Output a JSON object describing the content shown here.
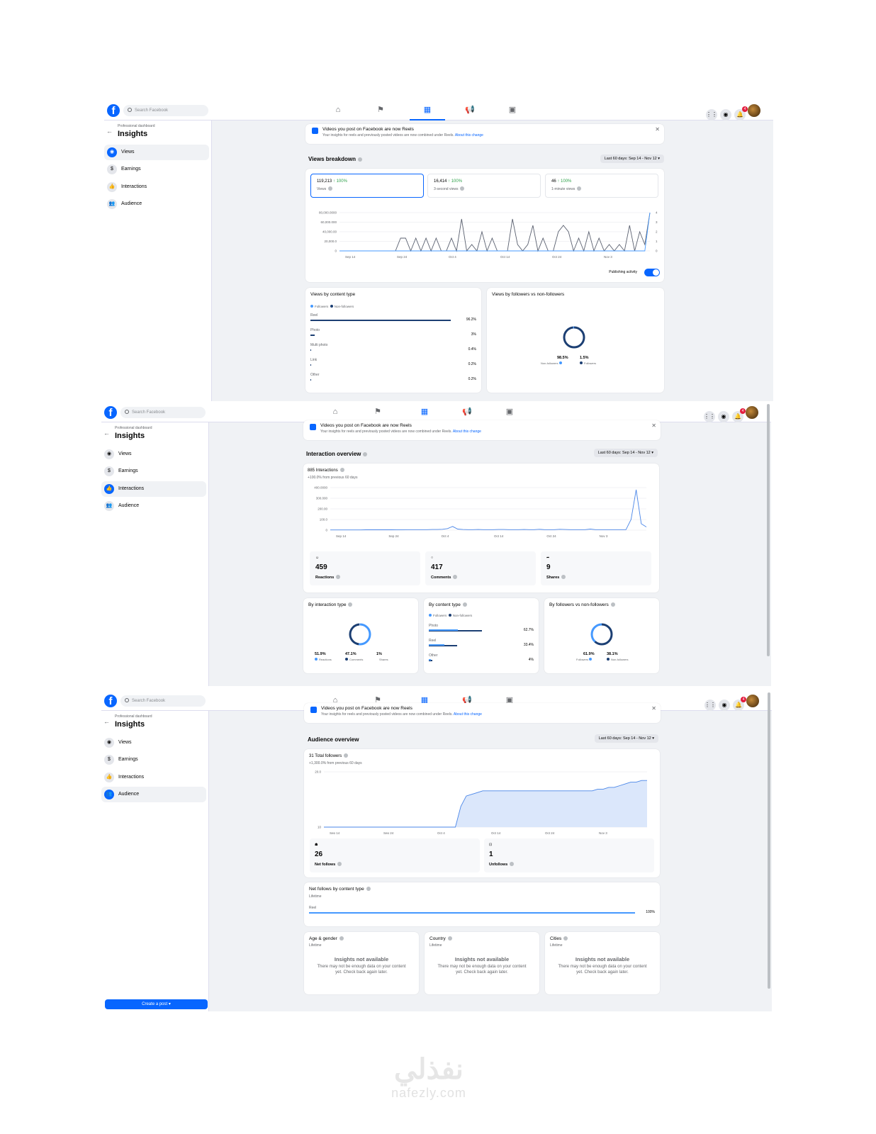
{
  "app": {
    "search_placeholder": "Search Facebook",
    "notif_count": "4",
    "dashboard_label": "Professional dashboard",
    "title": "Insights",
    "create_post": "Create a post ▾"
  },
  "menu": [
    {
      "label": "Views"
    },
    {
      "label": "Earnings"
    },
    {
      "label": "Interactions"
    },
    {
      "label": "Audience"
    }
  ],
  "notice": {
    "title": "Videos you post on Facebook are now Reels",
    "body": "Your insights for reels and previously posted videos are now combined under Reels.",
    "link": "About this change"
  },
  "range": "Last 60 days: Sep 14 - Nov 12 ▾",
  "views": {
    "section_title": "Views breakdown",
    "metrics": [
      {
        "value": "119,213",
        "change": "↑ 100%",
        "label": "Views"
      },
      {
        "value": "16,414",
        "change": "↑ 100%",
        "label": "3-second views"
      },
      {
        "value": "46",
        "change": "↑ 100%",
        "label": "1-minute views"
      }
    ],
    "publishing_label": "Publishing activity",
    "content_type": {
      "title": "Views by content type",
      "legend": [
        "Followers",
        "Non-followers"
      ],
      "rows": [
        {
          "label": "Reel",
          "value": "96.2%",
          "pct": 96.2
        },
        {
          "label": "Photo",
          "value": "3%",
          "pct": 3
        },
        {
          "label": "Multi photo",
          "value": "0.4%",
          "pct": 0.4
        },
        {
          "label": "Link",
          "value": "0.2%",
          "pct": 0.2
        },
        {
          "label": "Other",
          "value": "0.2%",
          "pct": 0.2
        }
      ]
    },
    "followers": {
      "title": "Views by followers vs non-followers",
      "items": [
        {
          "value": "98.5%",
          "label": "Non-followers"
        },
        {
          "value": "1.5%",
          "label": "Followers"
        }
      ]
    }
  },
  "interactions": {
    "section_title": "Interaction overview",
    "total": "885 Interactions",
    "change": "+100.0% from previous 60 days",
    "stats": [
      {
        "value": "459",
        "label": "Reactions"
      },
      {
        "value": "417",
        "label": "Comments"
      },
      {
        "value": "9",
        "label": "Shares"
      }
    ],
    "by_type": {
      "title": "By interaction type",
      "items": [
        {
          "value": "51.9%",
          "label": "Reactions"
        },
        {
          "value": "47.1%",
          "label": "Comments"
        },
        {
          "value": "1%",
          "label": "Shares"
        }
      ]
    },
    "by_content": {
      "title": "By content type",
      "legend": [
        "Followers",
        "Non-followers"
      ],
      "rows": [
        {
          "label": "Photo",
          "value": "62.7%",
          "pct": 62.7
        },
        {
          "label": "Reel",
          "value": "33.4%",
          "pct": 33.4
        },
        {
          "label": "Other",
          "value": "4%",
          "pct": 4
        }
      ]
    },
    "by_followers": {
      "title": "By followers vs non-followers",
      "items": [
        {
          "value": "61.9%",
          "label": "Followers"
        },
        {
          "value": "38.1%",
          "label": "Non-followers"
        }
      ]
    }
  },
  "audience": {
    "section_title": "Audience overview",
    "total": "31 Total followers",
    "change": "+1,300.0% from previous 60 days",
    "stats": [
      {
        "value": "26",
        "label": "Net follows"
      },
      {
        "value": "1",
        "label": "Unfollows"
      }
    ],
    "net_content": {
      "title": "Net follows by content type",
      "sub": "Lifetime",
      "row": {
        "label": "Reel",
        "value": "100%",
        "pct": 100
      }
    },
    "cards": [
      {
        "title": "Age & gender",
        "sub": "Lifetime",
        "na_title": "Insights not available",
        "na_body": "There may not be enough data on your content yet. Check back again later."
      },
      {
        "title": "Country",
        "sub": "Lifetime",
        "na_title": "Insights not available",
        "na_body": "There may not be enough data on your content yet. Check back again later."
      },
      {
        "title": "Cities",
        "sub": "Lifetime",
        "na_title": "Insights not available",
        "na_body": "There may not be enough data on your content yet. Check back again later."
      }
    ]
  },
  "watermark": {
    "arabic": "نفذلي",
    "latin": "nafezly.com"
  },
  "chart_data": [
    {
      "type": "line",
      "title": "Views breakdown",
      "x_ticks": [
        "Sep 14",
        "Sep 24",
        "Oct 4",
        "Oct 14",
        "Oct 24",
        "Nov 3"
      ],
      "y_ticks": [
        "80,000.0000",
        "60,000.000",
        "40,000.00",
        "20,000.0",
        "0"
      ],
      "y2_ticks": [
        "4",
        "3",
        "2",
        "1",
        "0"
      ],
      "series": [
        {
          "name": "Views",
          "values": [
            0,
            0,
            0,
            0,
            0,
            0,
            0,
            0,
            0,
            0,
            0,
            0,
            2,
            2,
            0,
            2,
            0,
            2,
            0,
            2,
            0,
            0,
            2,
            0,
            5,
            0,
            1,
            0,
            3,
            0,
            2,
            0,
            0,
            0,
            5,
            1,
            0,
            1,
            4,
            0,
            2,
            0,
            0,
            3,
            4,
            3,
            0,
            2,
            0,
            3,
            0,
            2,
            0,
            1,
            0,
            1,
            0,
            4,
            0,
            3,
            1,
            6
          ]
        },
        {
          "name": "Publishing activity",
          "values": [
            0,
            0,
            0,
            0,
            0,
            0,
            0,
            0,
            0,
            0,
            0,
            0,
            0,
            0,
            0,
            0,
            0,
            0,
            0,
            0,
            0,
            0,
            0,
            0,
            0,
            0,
            0,
            0,
            0,
            0,
            0,
            0,
            0,
            0,
            0,
            0,
            0,
            0,
            0,
            0,
            0,
            0,
            0,
            0,
            0,
            0,
            0,
            0,
            0,
            0,
            0,
            0,
            0,
            0,
            0,
            0,
            0,
            0,
            0,
            0,
            0,
            4
          ]
        }
      ]
    },
    {
      "type": "line",
      "title": "Interaction overview",
      "x_ticks": [
        "Sep 14",
        "Sep 24",
        "Oct 4",
        "Oct 14",
        "Oct 24",
        "Nov 3"
      ],
      "y_ticks": [
        "400.0000",
        "300.000",
        "200.00",
        "100.0",
        "0"
      ],
      "series": [
        {
          "name": "Interactions",
          "values": [
            2,
            2,
            2,
            2,
            2,
            2,
            2,
            3,
            3,
            4,
            3,
            3,
            3,
            4,
            4,
            5,
            5,
            5,
            5,
            5,
            6,
            6,
            8,
            15,
            35,
            10,
            6,
            5,
            5,
            6,
            5,
            5,
            5,
            6,
            6,
            5,
            5,
            5,
            6,
            5,
            5,
            8,
            5,
            5,
            5,
            8,
            6,
            5,
            5,
            5,
            5,
            10,
            5,
            5,
            5,
            5,
            5,
            5,
            5,
            100,
            380,
            60,
            30
          ]
        }
      ]
    },
    {
      "type": "area",
      "title": "Audience overview",
      "x_ticks": [
        "Sep 14",
        "Sep 24",
        "Oct 4",
        "Oct 14",
        "Oct 24",
        "Nov 3"
      ],
      "y_ticks": [
        "20.0",
        "10"
      ],
      "series": [
        {
          "name": "Total followers",
          "values": [
            0,
            0,
            0,
            0,
            0,
            0,
            0,
            0,
            0,
            0,
            0,
            0,
            0,
            0,
            0,
            0,
            0,
            0,
            0,
            0,
            0,
            0,
            0,
            0,
            0,
            12,
            18,
            19,
            20,
            21,
            21,
            21,
            21,
            21,
            21,
            21,
            21,
            21,
            21,
            21,
            21,
            21,
            21,
            21,
            21,
            21,
            21,
            21,
            21,
            21,
            22,
            22,
            23,
            23,
            24,
            25,
            26,
            26,
            27,
            27
          ]
        }
      ]
    },
    {
      "type": "bar",
      "title": "Views by content type",
      "categories": [
        "Reel",
        "Photo",
        "Multi photo",
        "Link",
        "Other"
      ],
      "values": [
        96.2,
        3,
        0.4,
        0.2,
        0.2
      ]
    },
    {
      "type": "pie",
      "title": "Views by followers vs non-followers",
      "categories": [
        "Non-followers",
        "Followers"
      ],
      "values": [
        98.5,
        1.5
      ]
    },
    {
      "type": "pie",
      "title": "By interaction type",
      "categories": [
        "Reactions",
        "Comments",
        "Shares"
      ],
      "values": [
        51.9,
        47.1,
        1
      ]
    },
    {
      "type": "bar",
      "title": "By content type",
      "categories": [
        "Photo",
        "Reel",
        "Other"
      ],
      "values": [
        62.7,
        33.4,
        4
      ]
    },
    {
      "type": "pie",
      "title": "By followers vs non-followers",
      "categories": [
        "Followers",
        "Non-followers"
      ],
      "values": [
        61.9,
        38.1
      ]
    },
    {
      "type": "bar",
      "title": "Net follows by content type",
      "categories": [
        "Reel"
      ],
      "values": [
        100
      ]
    }
  ]
}
